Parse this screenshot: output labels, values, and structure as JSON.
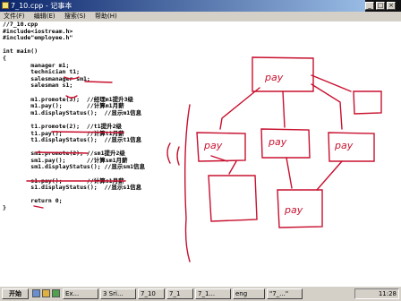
{
  "window": {
    "title": "7_10.cpp - 记事本"
  },
  "menu": [
    "文件(F)",
    "编辑(E)",
    "搜索(S)",
    "帮助(H)"
  ],
  "code_lines": [
    "//7_10.cpp",
    "#include<iostream.h>",
    "#include\"employee.h\"",
    "",
    "int main()",
    "{",
    "        manager m1;",
    "        technician t1;",
    "        salesmanager sm1;",
    "        salesman s1;",
    "",
    "        m1.promote(3);  //经理m1提升3级",
    "        m1.pay();       //计算m1月薪",
    "        m1.displayStatus();  //显示m1信息",
    "",
    "        t1.promote(2);  //t1提升2级",
    "        t1.pay();       //计算t1月薪",
    "        t1.displayStatus();  //显示t1信息",
    "",
    "        sm1.promote(2); //sm1提升2级",
    "        sm1.pay();      //计算sm1月薪",
    "        sm1.displayStatus(); //显示sm1信息",
    "",
    "        s1.pay();       //计算s1月薪",
    "        s1.displayStatus();  //显示s1信息",
    "",
    "        return 0;",
    "}"
  ],
  "annotations": {
    "pay_labels": [
      "pay",
      "pay",
      "pay",
      "pay",
      "pay"
    ],
    "ink_color": "#c8102e"
  },
  "taskbar": {
    "start_label": "开始",
    "buttons": [
      "Ex...",
      "3 Sri...",
      "7_10",
      "7_1",
      "7_1...",
      "eng",
      "\"7_...\""
    ],
    "clock": "11:28"
  }
}
